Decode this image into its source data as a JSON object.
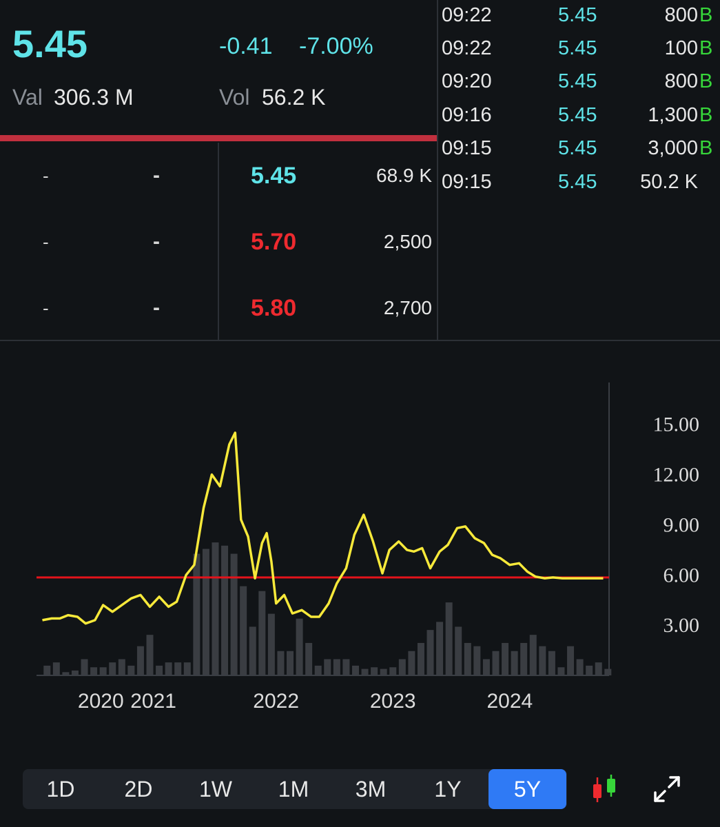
{
  "quote": {
    "last_price": "5.45",
    "change": "-0.41",
    "change_pct": "-7.00%",
    "val_label": "Val",
    "val_value": "306.3 M",
    "vol_label": "Vol",
    "vol_value": "56.2 K"
  },
  "order_book": {
    "rows": [
      {
        "bid_vol": "-",
        "bid_price": "-",
        "ask_price": "5.45",
        "ask_vol": "68.9 K",
        "ask_color": "#5fe3e8"
      },
      {
        "bid_vol": "-",
        "bid_price": "-",
        "ask_price": "5.70",
        "ask_vol": "2,500",
        "ask_color": "#ee2a2f"
      },
      {
        "bid_vol": "-",
        "bid_price": "-",
        "ask_price": "5.80",
        "ask_vol": "2,700",
        "ask_color": "#ee2a2f"
      }
    ]
  },
  "trades": [
    {
      "time": "09:22",
      "price": "5.45",
      "volume": "800",
      "side": "B"
    },
    {
      "time": "09:22",
      "price": "5.45",
      "volume": "100",
      "side": "B"
    },
    {
      "time": "09:20",
      "price": "5.45",
      "volume": "800",
      "side": "B"
    },
    {
      "time": "09:16",
      "price": "5.45",
      "volume": "1,300",
      "side": "B"
    },
    {
      "time": "09:15",
      "price": "5.45",
      "volume": "3,000",
      "side": "B"
    },
    {
      "time": "09:15",
      "price": "5.45",
      "volume": "50.2 K",
      "side": ""
    }
  ],
  "periods": {
    "items": [
      "1D",
      "2D",
      "1W",
      "1M",
      "3M",
      "1Y",
      "5Y"
    ],
    "selected": "5Y"
  },
  "icons": {
    "chart_type": "candlestick-icon",
    "expand": "expand-icon"
  },
  "colors": {
    "price_line": "#f7e93a",
    "reference_line": "#e3131b",
    "volume_bars": "#3a3d42",
    "up": "#37d63a",
    "down": "#ee2a2f",
    "accent": "#5fe3e8",
    "active_period": "#2f7af5"
  },
  "chart_data": {
    "type": "line",
    "title": "",
    "xlabel": "",
    "ylabel": "",
    "ylim": [
      0,
      17.5
    ],
    "y_ticks": [
      "15.00",
      "12.00",
      "9.00",
      "6.00",
      "3.00"
    ],
    "y_tick_values": [
      15,
      12,
      9,
      6,
      3
    ],
    "x_tick_labels": [
      {
        "label": "2020",
        "x": 2020.5
      },
      {
        "label": "2021",
        "x": 2020.95
      },
      {
        "label": "2022",
        "x": 2022.0
      },
      {
        "label": "2023",
        "x": 2023.0
      },
      {
        "label": "2024",
        "x": 2024.0
      }
    ],
    "xlim": [
      2019.95,
      2024.85
    ],
    "reference_line": 5.85,
    "grid": false,
    "series": [
      {
        "x": [
          2020.0,
          2020.08,
          2020.15,
          2020.22,
          2020.3,
          2020.37,
          2020.45,
          2020.52,
          2020.6,
          2020.68,
          2020.76,
          2020.84,
          2020.92,
          2021.0,
          2021.08,
          2021.15,
          2021.23,
          2021.3,
          2021.38,
          2021.45,
          2021.52,
          2021.6,
          2021.65,
          2021.7,
          2021.76,
          2021.82,
          2021.88,
          2021.92,
          2021.96,
          2022.0,
          2022.07,
          2022.14,
          2022.22,
          2022.3,
          2022.37,
          2022.45,
          2022.52,
          2022.6,
          2022.67,
          2022.75,
          2022.83,
          2022.91,
          2022.97,
          2023.05,
          2023.12,
          2023.18,
          2023.25,
          2023.32,
          2023.4,
          2023.47,
          2023.55,
          2023.62,
          2023.7,
          2023.78,
          2023.85,
          2023.92,
          2024.0,
          2024.08,
          2024.15,
          2024.22,
          2024.3,
          2024.37,
          2024.45,
          2024.52,
          2024.6,
          2024.68,
          2024.75,
          2024.8
        ],
        "y": [
          3.3,
          3.4,
          3.4,
          3.6,
          3.5,
          3.1,
          3.3,
          4.2,
          3.8,
          4.2,
          4.6,
          4.8,
          4.1,
          4.7,
          4.1,
          4.4,
          6.0,
          6.6,
          10.0,
          12.0,
          11.3,
          13.8,
          14.5,
          9.3,
          8.3,
          5.8,
          7.9,
          8.5,
          6.8,
          4.3,
          4.8,
          3.7,
          3.9,
          3.5,
          3.5,
          4.3,
          5.5,
          6.4,
          8.4,
          9.6,
          8.0,
          6.1,
          7.5,
          8.0,
          7.5,
          7.4,
          7.6,
          6.4,
          7.4,
          7.8,
          8.8,
          8.9,
          8.2,
          7.9,
          7.2,
          7.0,
          6.6,
          6.7,
          6.2,
          5.9,
          5.8,
          5.85,
          5.8,
          5.8,
          5.8,
          5.8,
          5.8,
          5.8
        ]
      }
    ],
    "volume_series": {
      "x": [
        2020.04,
        2020.12,
        2020.2,
        2020.28,
        2020.36,
        2020.44,
        2020.52,
        2020.6,
        2020.68,
        2020.76,
        2020.84,
        2020.92,
        2021.0,
        2021.08,
        2021.16,
        2021.24,
        2021.32,
        2021.4,
        2021.48,
        2021.56,
        2021.64,
        2021.72,
        2021.8,
        2021.88,
        2021.96,
        2022.04,
        2022.12,
        2022.2,
        2022.28,
        2022.36,
        2022.44,
        2022.52,
        2022.6,
        2022.68,
        2022.76,
        2022.84,
        2022.92,
        2023.0,
        2023.08,
        2023.16,
        2023.24,
        2023.32,
        2023.4,
        2023.48,
        2023.56,
        2023.64,
        2023.72,
        2023.8,
        2023.88,
        2023.96,
        2024.04,
        2024.12,
        2024.2,
        2024.28,
        2024.36,
        2024.44,
        2024.52,
        2024.6,
        2024.68,
        2024.76,
        2024.84
      ],
      "y": [
        0.06,
        0.08,
        0.02,
        0.03,
        0.1,
        0.05,
        0.05,
        0.08,
        0.1,
        0.06,
        0.18,
        0.25,
        0.06,
        0.08,
        0.08,
        0.08,
        0.75,
        0.78,
        0.82,
        0.8,
        0.75,
        0.55,
        0.3,
        0.52,
        0.38,
        0.15,
        0.15,
        0.35,
        0.2,
        0.06,
        0.1,
        0.1,
        0.1,
        0.06,
        0.04,
        0.05,
        0.04,
        0.05,
        0.1,
        0.15,
        0.2,
        0.28,
        0.33,
        0.45,
        0.3,
        0.2,
        0.18,
        0.1,
        0.15,
        0.2,
        0.15,
        0.2,
        0.25,
        0.18,
        0.15,
        0.05,
        0.18,
        0.1,
        0.06,
        0.08,
        0.04
      ]
    }
  }
}
